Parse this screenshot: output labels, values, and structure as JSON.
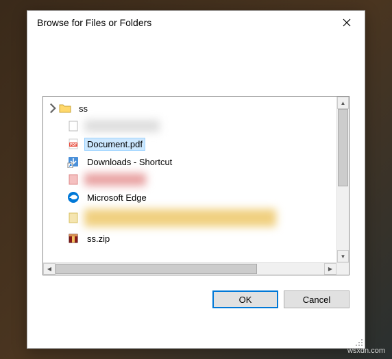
{
  "dialog": {
    "title": "Browse for Files or Folders"
  },
  "tree": {
    "root": {
      "label": "ss"
    },
    "items": [
      {
        "label": "",
        "blurred": true
      },
      {
        "label": "Document.pdf",
        "icon": "pdf",
        "selected": true
      },
      {
        "label": "Downloads - Shortcut",
        "icon": "shortcut"
      },
      {
        "label": "",
        "blurred": true,
        "tint": "red"
      },
      {
        "label": "Microsoft Edge",
        "icon": "edge"
      },
      {
        "label": "",
        "blurred": true,
        "tint": "yellow"
      },
      {
        "label": "ss.zip",
        "icon": "archive"
      }
    ]
  },
  "buttons": {
    "ok": "OK",
    "cancel": "Cancel"
  },
  "watermark": "wsxdn.com"
}
